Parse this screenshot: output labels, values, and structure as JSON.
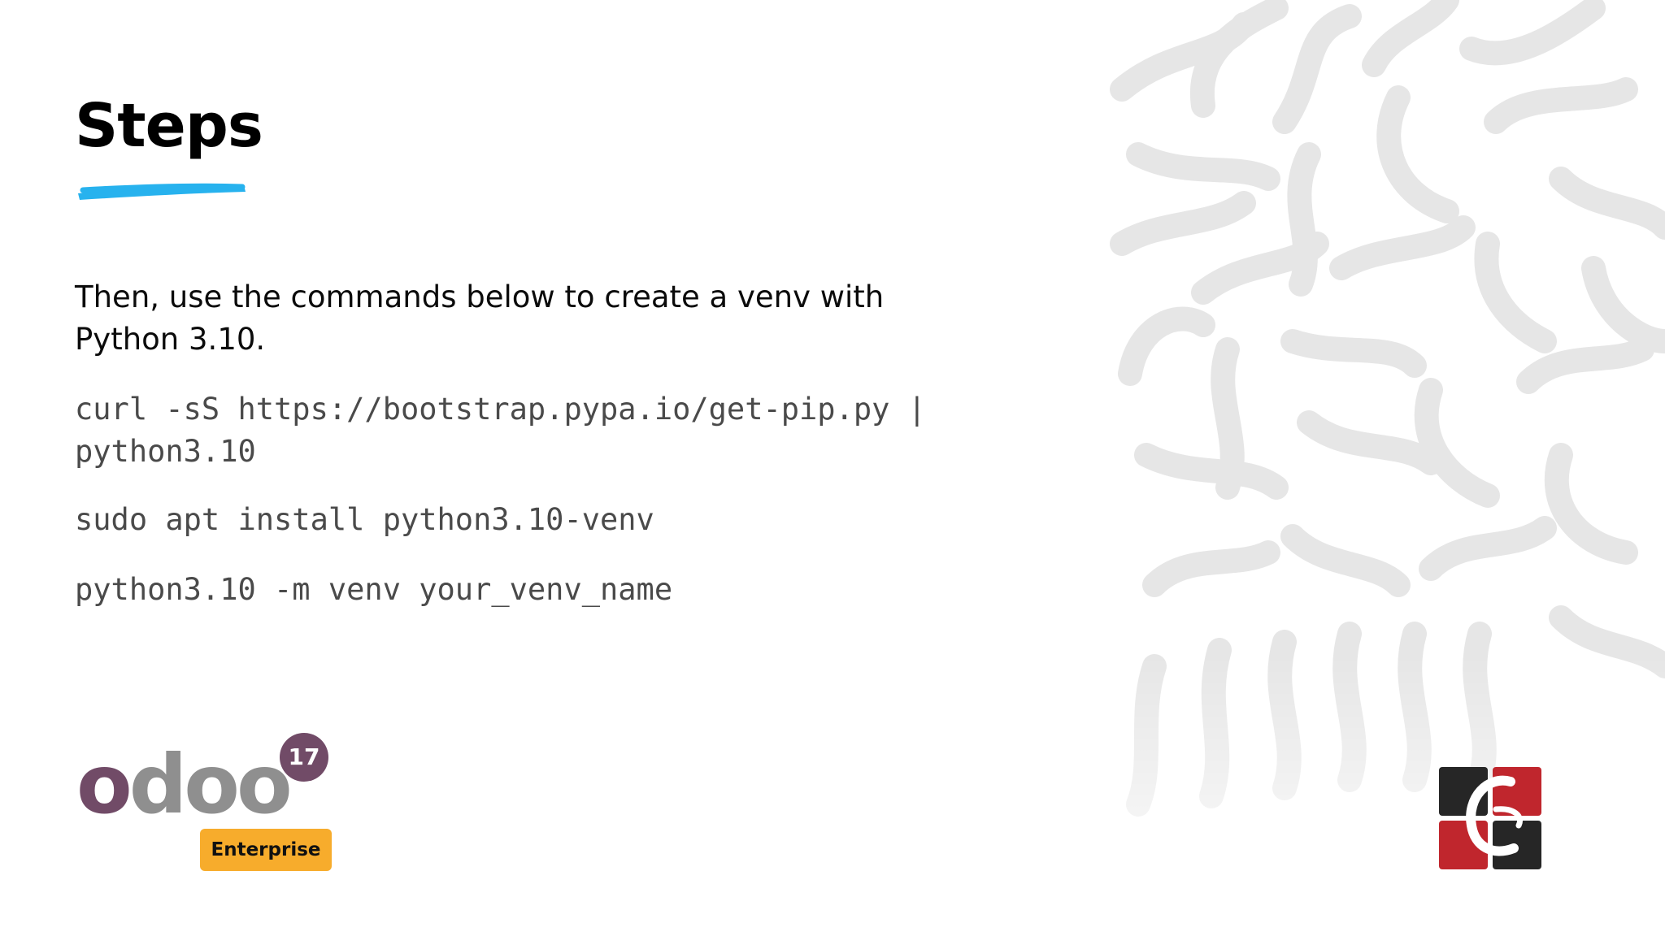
{
  "slide": {
    "title": "Steps",
    "intro": "Then, use the commands below to create a venv with Python 3.10.",
    "commands": [
      "curl -sS https://bootstrap.pypa.io/get-pip.py | python3.10",
      "sudo apt install python3.10-venv",
      "python3.10 -m venv your_venv_name"
    ]
  },
  "logo": {
    "wordmark": "odoo",
    "version": "17",
    "badge": "Enterprise"
  },
  "colors": {
    "underline": "#27b2ee",
    "odoo_purple": "#714b67",
    "odoo_gray": "#8f8f8f",
    "badge": "#f7ac2c",
    "brand_red": "#c0262d",
    "brand_dark": "#262626"
  },
  "icons": [
    "brush-underline-icon",
    "squiggle-pattern-icon",
    "brand-logo-icon"
  ]
}
